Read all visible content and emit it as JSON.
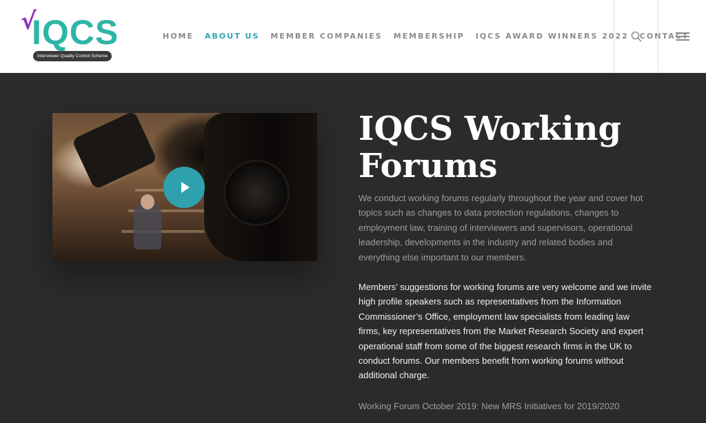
{
  "header": {
    "logo": {
      "check": "√",
      "wordmark": "IQCS",
      "tagline": "Interviewer Quality Control Scheme"
    },
    "nav": [
      {
        "label": "HOME",
        "active": false
      },
      {
        "label": "ABOUT US",
        "active": true
      },
      {
        "label": "MEMBER COMPANIES",
        "active": false
      },
      {
        "label": "MEMBERSHIP",
        "active": false
      },
      {
        "label": "IQCS AWARD WINNERS 2022",
        "active": false
      },
      {
        "label": "CONTACT",
        "active": false
      }
    ],
    "icons": {
      "search": "search-icon",
      "menu": "hamburger-menu-icon"
    }
  },
  "main": {
    "video": {
      "play_icon": "play-icon"
    },
    "title": "IQCS Working Forums",
    "paragraphs": [
      "We conduct working forums regularly throughout the year and cover hot topics such as changes to data protection regulations, changes to employment law, training of interviewers and supervisors, operational leadership, developments in the industry and related bodies and everything else important to our members.",
      "Members’ suggestions for working forums are very welcome and we invite high profile speakers such as representatives from the Information Commissioner’s Office, employment law specialists from leading law firms, key representatives from the Market Research Society and expert operational staff from some of the biggest research firms in the UK to conduct forums. Our members benefit from working forums without additional charge.",
      "Working Forum October 2019: New MRS Initiatives for 2019/2020"
    ]
  },
  "colors": {
    "brand_teal": "#2fb5a6",
    "brand_purple": "#8e2fbf",
    "nav_active": "#2fa5b0",
    "nav_default": "#8b8b8b",
    "page_background": "#2b2b2c",
    "play_button": "#2fa0ae"
  }
}
